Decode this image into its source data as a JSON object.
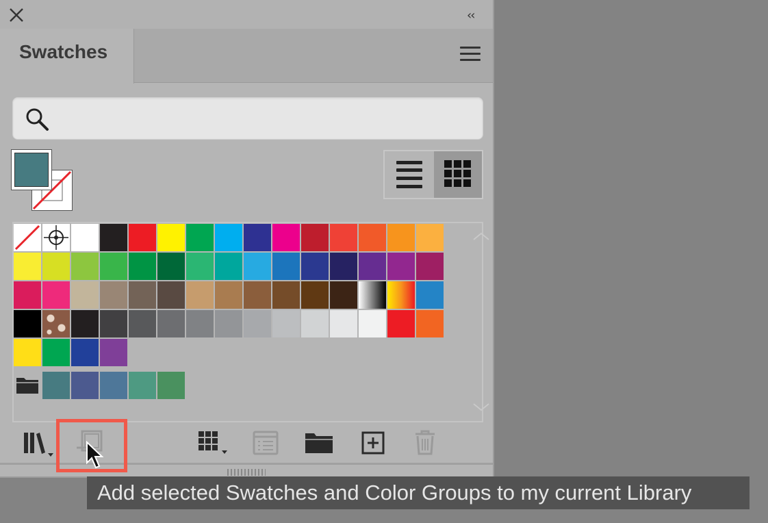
{
  "panel": {
    "tab_label": "Swatches",
    "search": {
      "placeholder": ""
    },
    "fill_color": "#477b81",
    "view_mode": "grid"
  },
  "swatches": {
    "row1": [
      "none",
      "registration",
      "#ffffff",
      "#231f20",
      "#ed1c24",
      "#fff200",
      "#00a651",
      "#00aeef",
      "#2e3192",
      "#ec008c",
      "#be1e2d",
      "#ef4136",
      "#f15a29",
      "#f7941d",
      "#fbb040"
    ],
    "row2": [
      "#f9ed32",
      "#d7df23",
      "#8dc63f",
      "#39b54a",
      "#009444",
      "#006838",
      "#2bb673",
      "#00a79d",
      "#27aae1",
      "#1c75bc",
      "#2b3990",
      "#262262",
      "#662d91",
      "#92278f",
      "#9e1f63"
    ],
    "row3": [
      "#da1c5c",
      "#ee2a7b",
      "#c2b59b",
      "#998675",
      "#736357",
      "#594a42",
      "#c69c6d",
      "#a97c50",
      "#8b5e3c",
      "#754c29",
      "#603913",
      "#3c2415",
      "gradient-bw",
      "gradient-orange",
      "#2484c6"
    ],
    "row4": [
      "#000000",
      "pattern",
      "#231f20",
      "#414042",
      "#58595b",
      "#6d6e71",
      "#808285",
      "#939598",
      "#a7a9ac",
      "#bcbec0",
      "#d1d3d4",
      "#e6e7e8",
      "#f1f2f2",
      "#ed1c24",
      "#f26522"
    ],
    "row5": [
      "#ffde17",
      "#00a651",
      "#21409a",
      "#7f3f98"
    ],
    "group": [
      "#477b81",
      "#4c5a8f",
      "#4e7799",
      "#4e9a82",
      "#4a915f"
    ]
  },
  "tooltip": {
    "text": "Add selected Swatches and Color Groups to my current Library"
  }
}
